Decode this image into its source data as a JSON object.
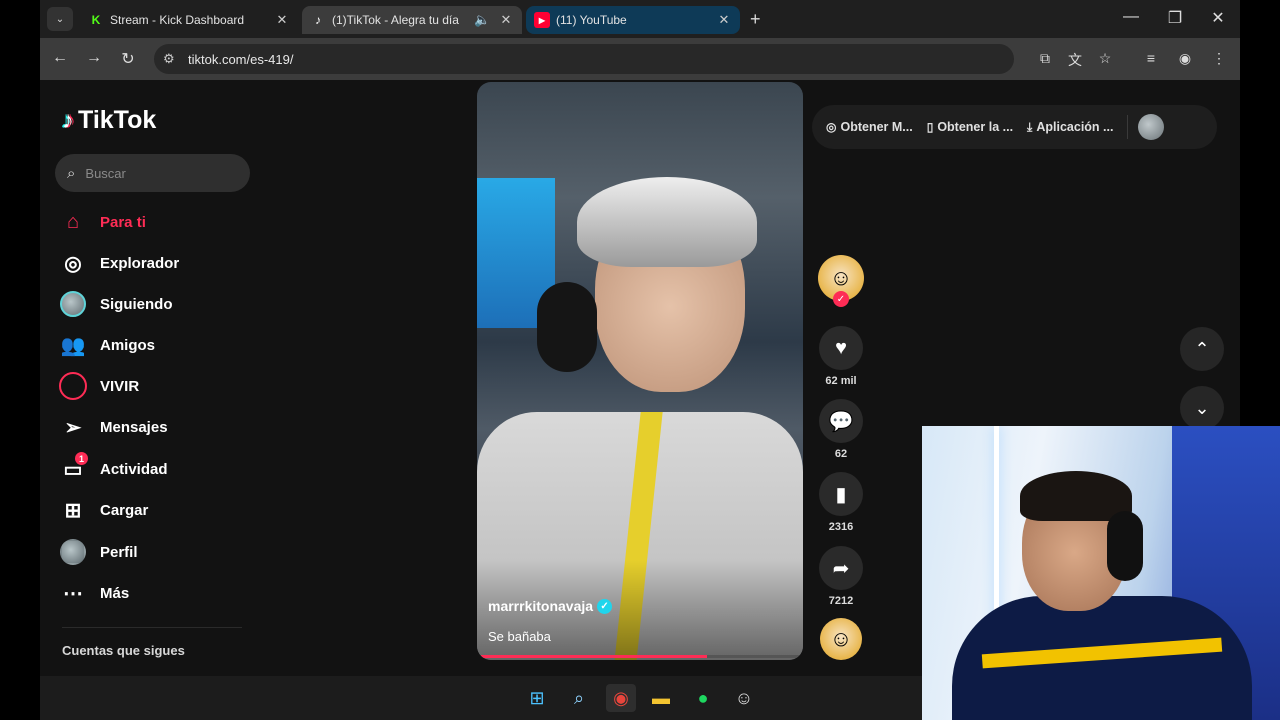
{
  "browser": {
    "tabs": [
      {
        "label": "Stream - Kick Dashboard",
        "favicon": "K"
      },
      {
        "label": "(1)TikTok - Alegra tu día",
        "favicon": "♪"
      },
      {
        "label": "(11) YouTube",
        "favicon": "▶"
      }
    ],
    "url": "tiktok.com/es-419/"
  },
  "tiktok": {
    "logo": "TikTok",
    "search_placeholder": "Buscar",
    "nav": [
      {
        "label": "Para ti",
        "icon": "home-icon"
      },
      {
        "label": "Explorador",
        "icon": "compass-icon"
      },
      {
        "label": "Siguiendo",
        "icon": "following-avatar"
      },
      {
        "label": "Amigos",
        "icon": "friends-icon"
      },
      {
        "label": "VIVIR",
        "icon": "live-icon"
      },
      {
        "label": "Mensajes",
        "icon": "send-icon"
      },
      {
        "label": "Actividad",
        "icon": "activity-icon",
        "badge": "1"
      },
      {
        "label": "Cargar",
        "icon": "upload-icon"
      },
      {
        "label": "Perfil",
        "icon": "profile-avatar"
      },
      {
        "label": "Más",
        "icon": "more-icon"
      }
    ],
    "following_heading": "Cuentas que sigues",
    "video": {
      "username": "marrrkitonavaja",
      "description": "Se bañaba",
      "progress": 0.71
    },
    "actions": {
      "likes": "62 mil",
      "comments": "62",
      "saves": "2316",
      "shares": "7212"
    },
    "topbar": [
      {
        "label": "Obtener M...",
        "icon": "coin-icon"
      },
      {
        "label": "Obtener la ...",
        "icon": "phone-icon"
      },
      {
        "label": "Aplicación ...",
        "icon": "download-icon"
      }
    ]
  },
  "colors": {
    "accent": "#fe2c55",
    "verified": "#20d5ec"
  }
}
